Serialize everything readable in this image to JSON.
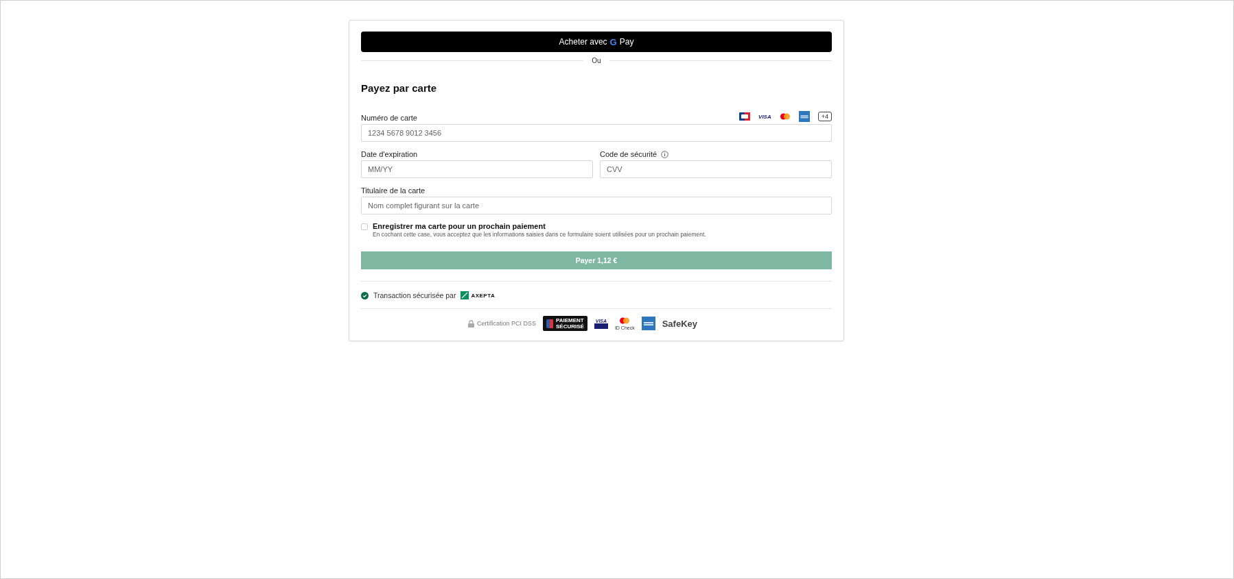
{
  "gpay_button": {
    "label": "Acheter avec",
    "brand_mark": "G",
    "brand": "Pay"
  },
  "separator": "Ou",
  "heading": "Payez par carte",
  "card_number": {
    "label": "Numéro de carte",
    "placeholder": "1234 5678 9012 3456",
    "brands": [
      {
        "kind": "cb"
      },
      {
        "kind": "visa",
        "text": "VISA"
      },
      {
        "kind": "mastercard"
      },
      {
        "kind": "amex"
      }
    ],
    "more": "+4"
  },
  "expiry": {
    "label": "Date d'expiration",
    "placeholder": "MM/YY"
  },
  "cvv": {
    "label": "Code de sécurité",
    "placeholder": "CVV"
  },
  "holder": {
    "label": "Titulaire de la carte",
    "placeholder": "Nom complet figurant sur la carte"
  },
  "save_card": {
    "label": "Enregistrer ma carte pour un prochain paiement",
    "hint": "En cochant cette case, vous acceptez que les informations saisies dans ce formulaire soient utilisées pour un prochain paiement.",
    "checked": false
  },
  "pay_button": {
    "label": "Payer 1,12 €",
    "disabled": true
  },
  "secured": {
    "text": "Transaction sécurisée par",
    "logo": "AXEPTA"
  },
  "certifications": [
    {
      "kind": "pci",
      "text": "Certification PCI DSS"
    },
    {
      "kind": "paiement_securise",
      "lines": [
        "PAIEMENT",
        "SÉCURISÉ"
      ]
    },
    {
      "kind": "visa_secure",
      "text": "VISA"
    },
    {
      "kind": "id_check",
      "text": "ID Check"
    },
    {
      "kind": "amex"
    },
    {
      "kind": "safekey",
      "text": "SafeKey"
    }
  ]
}
